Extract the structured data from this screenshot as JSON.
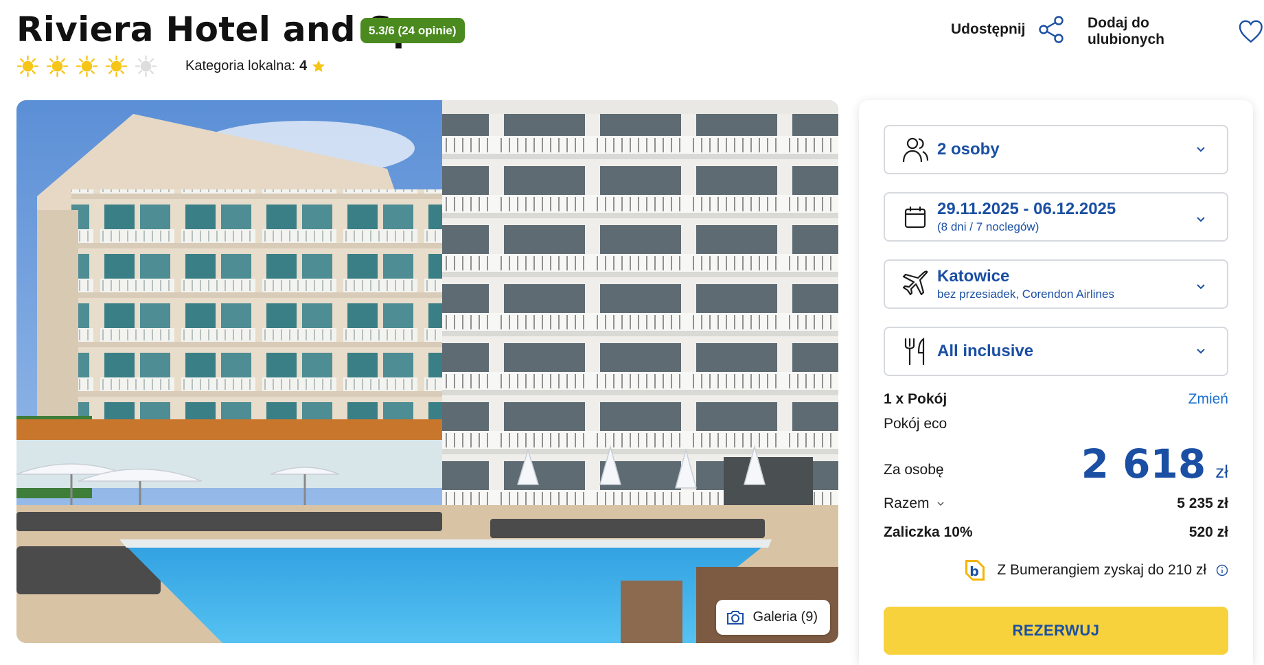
{
  "hotel": {
    "name": "Riviera Hotel and Spa",
    "rating_badge": "5.3/6 (24 opinie)",
    "suns_total": 5,
    "suns_filled": 4,
    "local_category_label": "Kategoria lokalna:",
    "local_category_value": "4"
  },
  "actions": {
    "share_label": "Udostępnij",
    "favorite_label": "Dodaj do ulubionych"
  },
  "gallery": {
    "button_label": "Galeria (9)"
  },
  "booking": {
    "people": {
      "label": "2 osoby"
    },
    "dates": {
      "range": "29.11.2025 - 06.12.2025",
      "duration": "(8 dni / 7 noclegów)"
    },
    "flight": {
      "city": "Katowice",
      "details": "bez przesiadek, Corendon Airlines"
    },
    "board": {
      "label": "All inclusive"
    },
    "room_count": "1 x Pokój",
    "change_link": "Zmień",
    "room_type": "Pokój eco",
    "per_person_label": "Za osobę",
    "price_per_person": "2 618",
    "currency": "zł",
    "total_label": "Razem",
    "total_value": "5 235 zł",
    "deposit_label": "Zaliczka 10%",
    "deposit_value": "520 zł",
    "bumerang_text": "Z Bumerangiem zyskaj do 210 zł",
    "reserve_label": "REZERWUJ"
  },
  "colors": {
    "brand_blue": "#1a4fa3",
    "badge_green": "#4a8a1f",
    "sun_yellow": "#f5c518",
    "reserve_yellow": "#f7d23c"
  }
}
